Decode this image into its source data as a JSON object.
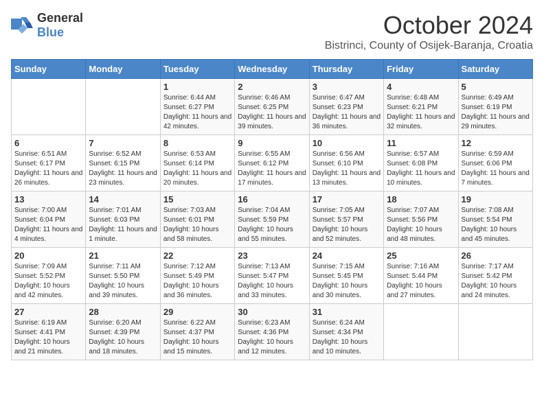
{
  "logo": {
    "general": "General",
    "blue": "Blue",
    "tagline": "GeneralBlue"
  },
  "header": {
    "month": "October 2024",
    "location": "Bistrinci, County of Osijek-Baranja, Croatia"
  },
  "weekdays": [
    "Sunday",
    "Monday",
    "Tuesday",
    "Wednesday",
    "Thursday",
    "Friday",
    "Saturday"
  ],
  "weeks": [
    [
      {
        "day": "",
        "sunrise": "",
        "sunset": "",
        "daylight": ""
      },
      {
        "day": "",
        "sunrise": "",
        "sunset": "",
        "daylight": ""
      },
      {
        "day": "1",
        "sunrise": "Sunrise: 6:44 AM",
        "sunset": "Sunset: 6:27 PM",
        "daylight": "Daylight: 11 hours and 42 minutes."
      },
      {
        "day": "2",
        "sunrise": "Sunrise: 6:46 AM",
        "sunset": "Sunset: 6:25 PM",
        "daylight": "Daylight: 11 hours and 39 minutes."
      },
      {
        "day": "3",
        "sunrise": "Sunrise: 6:47 AM",
        "sunset": "Sunset: 6:23 PM",
        "daylight": "Daylight: 11 hours and 36 minutes."
      },
      {
        "day": "4",
        "sunrise": "Sunrise: 6:48 AM",
        "sunset": "Sunset: 6:21 PM",
        "daylight": "Daylight: 11 hours and 32 minutes."
      },
      {
        "day": "5",
        "sunrise": "Sunrise: 6:49 AM",
        "sunset": "Sunset: 6:19 PM",
        "daylight": "Daylight: 11 hours and 29 minutes."
      }
    ],
    [
      {
        "day": "6",
        "sunrise": "Sunrise: 6:51 AM",
        "sunset": "Sunset: 6:17 PM",
        "daylight": "Daylight: 11 hours and 26 minutes."
      },
      {
        "day": "7",
        "sunrise": "Sunrise: 6:52 AM",
        "sunset": "Sunset: 6:15 PM",
        "daylight": "Daylight: 11 hours and 23 minutes."
      },
      {
        "day": "8",
        "sunrise": "Sunrise: 6:53 AM",
        "sunset": "Sunset: 6:14 PM",
        "daylight": "Daylight: 11 hours and 20 minutes."
      },
      {
        "day": "9",
        "sunrise": "Sunrise: 6:55 AM",
        "sunset": "Sunset: 6:12 PM",
        "daylight": "Daylight: 11 hours and 17 minutes."
      },
      {
        "day": "10",
        "sunrise": "Sunrise: 6:56 AM",
        "sunset": "Sunset: 6:10 PM",
        "daylight": "Daylight: 11 hours and 13 minutes."
      },
      {
        "day": "11",
        "sunrise": "Sunrise: 6:57 AM",
        "sunset": "Sunset: 6:08 PM",
        "daylight": "Daylight: 11 hours and 10 minutes."
      },
      {
        "day": "12",
        "sunrise": "Sunrise: 6:59 AM",
        "sunset": "Sunset: 6:06 PM",
        "daylight": "Daylight: 11 hours and 7 minutes."
      }
    ],
    [
      {
        "day": "13",
        "sunrise": "Sunrise: 7:00 AM",
        "sunset": "Sunset: 6:04 PM",
        "daylight": "Daylight: 11 hours and 4 minutes."
      },
      {
        "day": "14",
        "sunrise": "Sunrise: 7:01 AM",
        "sunset": "Sunset: 6:03 PM",
        "daylight": "Daylight: 11 hours and 1 minute."
      },
      {
        "day": "15",
        "sunrise": "Sunrise: 7:03 AM",
        "sunset": "Sunset: 6:01 PM",
        "daylight": "Daylight: 10 hours and 58 minutes."
      },
      {
        "day": "16",
        "sunrise": "Sunrise: 7:04 AM",
        "sunset": "Sunset: 5:59 PM",
        "daylight": "Daylight: 10 hours and 55 minutes."
      },
      {
        "day": "17",
        "sunrise": "Sunrise: 7:05 AM",
        "sunset": "Sunset: 5:57 PM",
        "daylight": "Daylight: 10 hours and 52 minutes."
      },
      {
        "day": "18",
        "sunrise": "Sunrise: 7:07 AM",
        "sunset": "Sunset: 5:56 PM",
        "daylight": "Daylight: 10 hours and 48 minutes."
      },
      {
        "day": "19",
        "sunrise": "Sunrise: 7:08 AM",
        "sunset": "Sunset: 5:54 PM",
        "daylight": "Daylight: 10 hours and 45 minutes."
      }
    ],
    [
      {
        "day": "20",
        "sunrise": "Sunrise: 7:09 AM",
        "sunset": "Sunset: 5:52 PM",
        "daylight": "Daylight: 10 hours and 42 minutes."
      },
      {
        "day": "21",
        "sunrise": "Sunrise: 7:11 AM",
        "sunset": "Sunset: 5:50 PM",
        "daylight": "Daylight: 10 hours and 39 minutes."
      },
      {
        "day": "22",
        "sunrise": "Sunrise: 7:12 AM",
        "sunset": "Sunset: 5:49 PM",
        "daylight": "Daylight: 10 hours and 36 minutes."
      },
      {
        "day": "23",
        "sunrise": "Sunrise: 7:13 AM",
        "sunset": "Sunset: 5:47 PM",
        "daylight": "Daylight: 10 hours and 33 minutes."
      },
      {
        "day": "24",
        "sunrise": "Sunrise: 7:15 AM",
        "sunset": "Sunset: 5:45 PM",
        "daylight": "Daylight: 10 hours and 30 minutes."
      },
      {
        "day": "25",
        "sunrise": "Sunrise: 7:16 AM",
        "sunset": "Sunset: 5:44 PM",
        "daylight": "Daylight: 10 hours and 27 minutes."
      },
      {
        "day": "26",
        "sunrise": "Sunrise: 7:17 AM",
        "sunset": "Sunset: 5:42 PM",
        "daylight": "Daylight: 10 hours and 24 minutes."
      }
    ],
    [
      {
        "day": "27",
        "sunrise": "Sunrise: 6:19 AM",
        "sunset": "Sunset: 4:41 PM",
        "daylight": "Daylight: 10 hours and 21 minutes."
      },
      {
        "day": "28",
        "sunrise": "Sunrise: 6:20 AM",
        "sunset": "Sunset: 4:39 PM",
        "daylight": "Daylight: 10 hours and 18 minutes."
      },
      {
        "day": "29",
        "sunrise": "Sunrise: 6:22 AM",
        "sunset": "Sunset: 4:37 PM",
        "daylight": "Daylight: 10 hours and 15 minutes."
      },
      {
        "day": "30",
        "sunrise": "Sunrise: 6:23 AM",
        "sunset": "Sunset: 4:36 PM",
        "daylight": "Daylight: 10 hours and 12 minutes."
      },
      {
        "day": "31",
        "sunrise": "Sunrise: 6:24 AM",
        "sunset": "Sunset: 4:34 PM",
        "daylight": "Daylight: 10 hours and 10 minutes."
      },
      {
        "day": "",
        "sunrise": "",
        "sunset": "",
        "daylight": ""
      },
      {
        "day": "",
        "sunrise": "",
        "sunset": "",
        "daylight": ""
      }
    ]
  ]
}
